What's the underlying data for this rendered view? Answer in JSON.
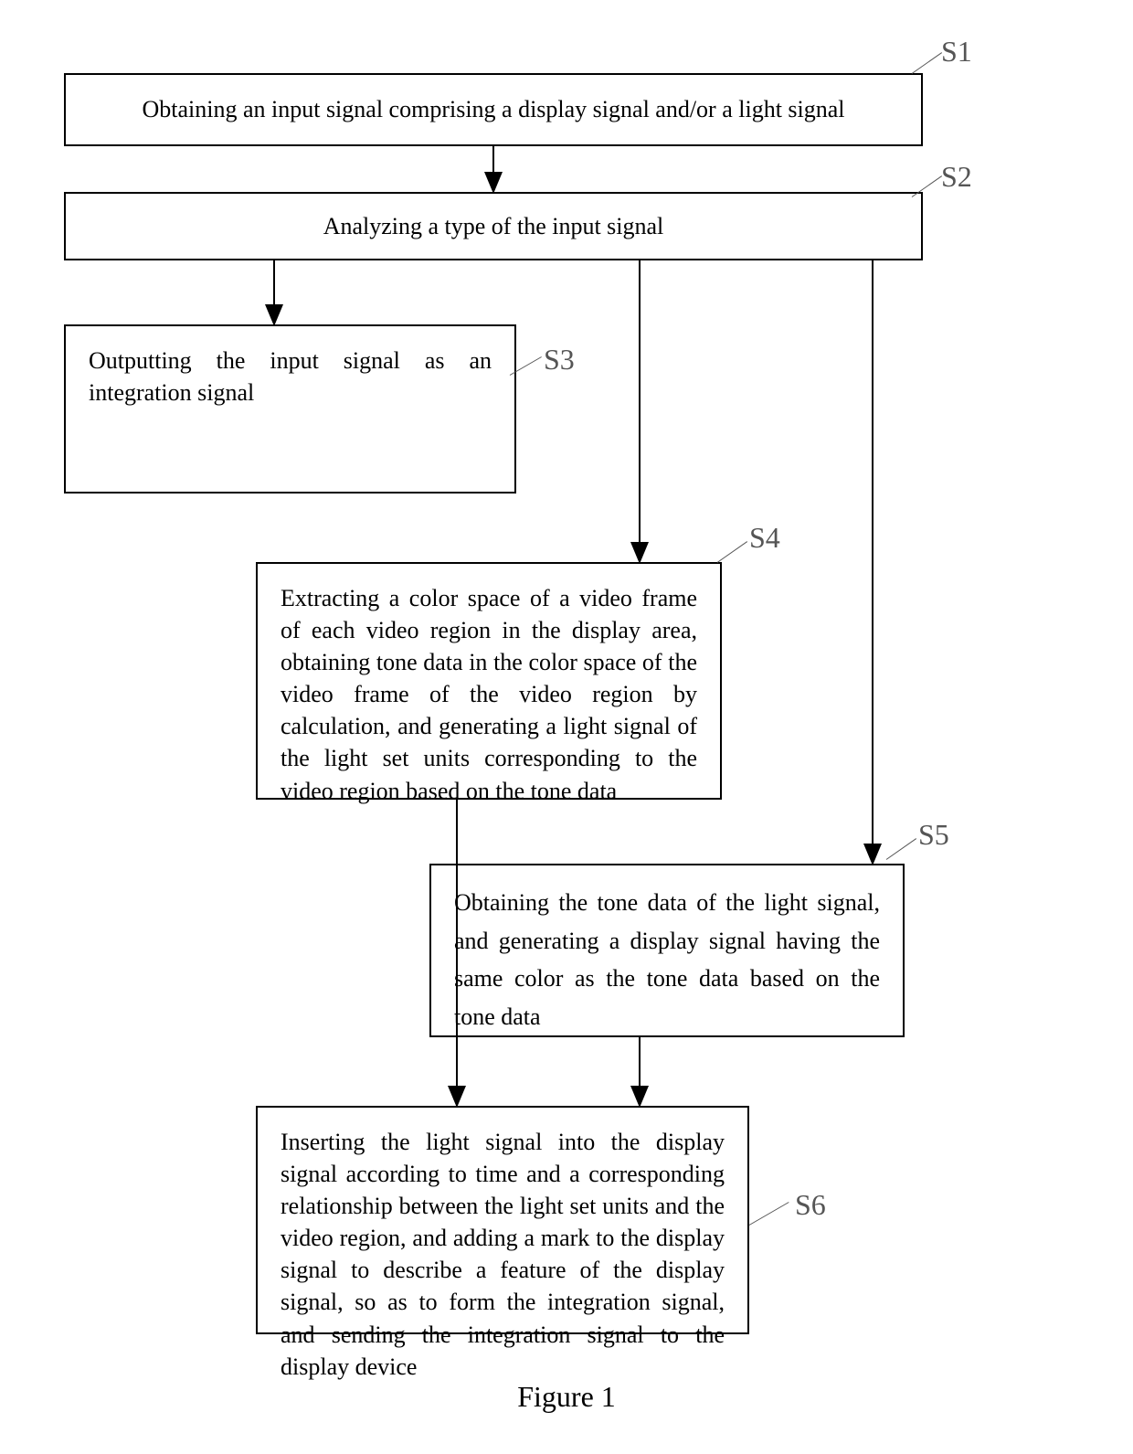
{
  "nodes": {
    "s1": {
      "label": "S1",
      "text": "Obtaining an input signal comprising a display signal and/or a light signal"
    },
    "s2": {
      "label": "S2",
      "text": "Analyzing a type of the input signal"
    },
    "s3": {
      "label": "S3",
      "text": "Outputting the input signal as an integration signal"
    },
    "s4": {
      "label": "S4",
      "text": "Extracting a color space of a video frame of each video region in the display area, obtaining tone data in the color space of the video frame of the video region by calculation, and generating a light signal of the light set units corresponding to the video region based on the tone data"
    },
    "s5": {
      "label": "S5",
      "text": "Obtaining the tone data of the light signal, and generating a display signal having the same color as the tone data based on the tone data"
    },
    "s6": {
      "label": "S6",
      "text": "Inserting the light signal into the display signal according to time and a corresponding relationship between the light set units and the video region, and adding a mark to the display signal to describe a feature of the display signal, so as to form the integration signal, and sending the integration signal to the display device"
    }
  },
  "figure_label": "Figure 1",
  "edges": [
    {
      "from": "s1",
      "to": "s2"
    },
    {
      "from": "s2",
      "to": "s3"
    },
    {
      "from": "s2",
      "to": "s4"
    },
    {
      "from": "s2",
      "to": "s5"
    },
    {
      "from": "s4",
      "to": "s6"
    },
    {
      "from": "s5",
      "to": "s6"
    }
  ]
}
